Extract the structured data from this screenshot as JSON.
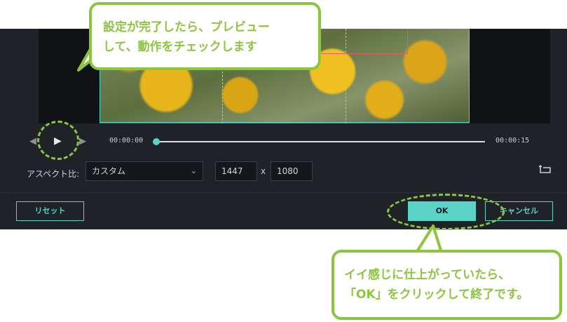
{
  "player": {
    "current_time": "00:00:00",
    "total_time": "00:00:15",
    "progress": 0
  },
  "aspect": {
    "label": "アスペクト比:",
    "selected": "カスタム",
    "width": "1447",
    "separator": "x",
    "height": "1080"
  },
  "buttons": {
    "reset": "リセット",
    "ok": "OK",
    "cancel": "キャンセル"
  },
  "callouts": {
    "top_line1": "設定が完了したら、プレビュー",
    "top_line2": "して、動作をチェックします",
    "bottom_line1": "イイ感じに仕上がっていたら、",
    "bottom_line2": "「OK」をクリックして終了です。"
  },
  "colors": {
    "accent": "#5ad3c6",
    "callout": "#8cc63f",
    "panel": "#1f2227"
  },
  "icons": {
    "prev": "prev-frame-icon",
    "play": "play-icon",
    "next": "next-frame-icon",
    "dropdown": "chevron-down-icon",
    "crop_rotate": "crop-rotate-icon"
  }
}
